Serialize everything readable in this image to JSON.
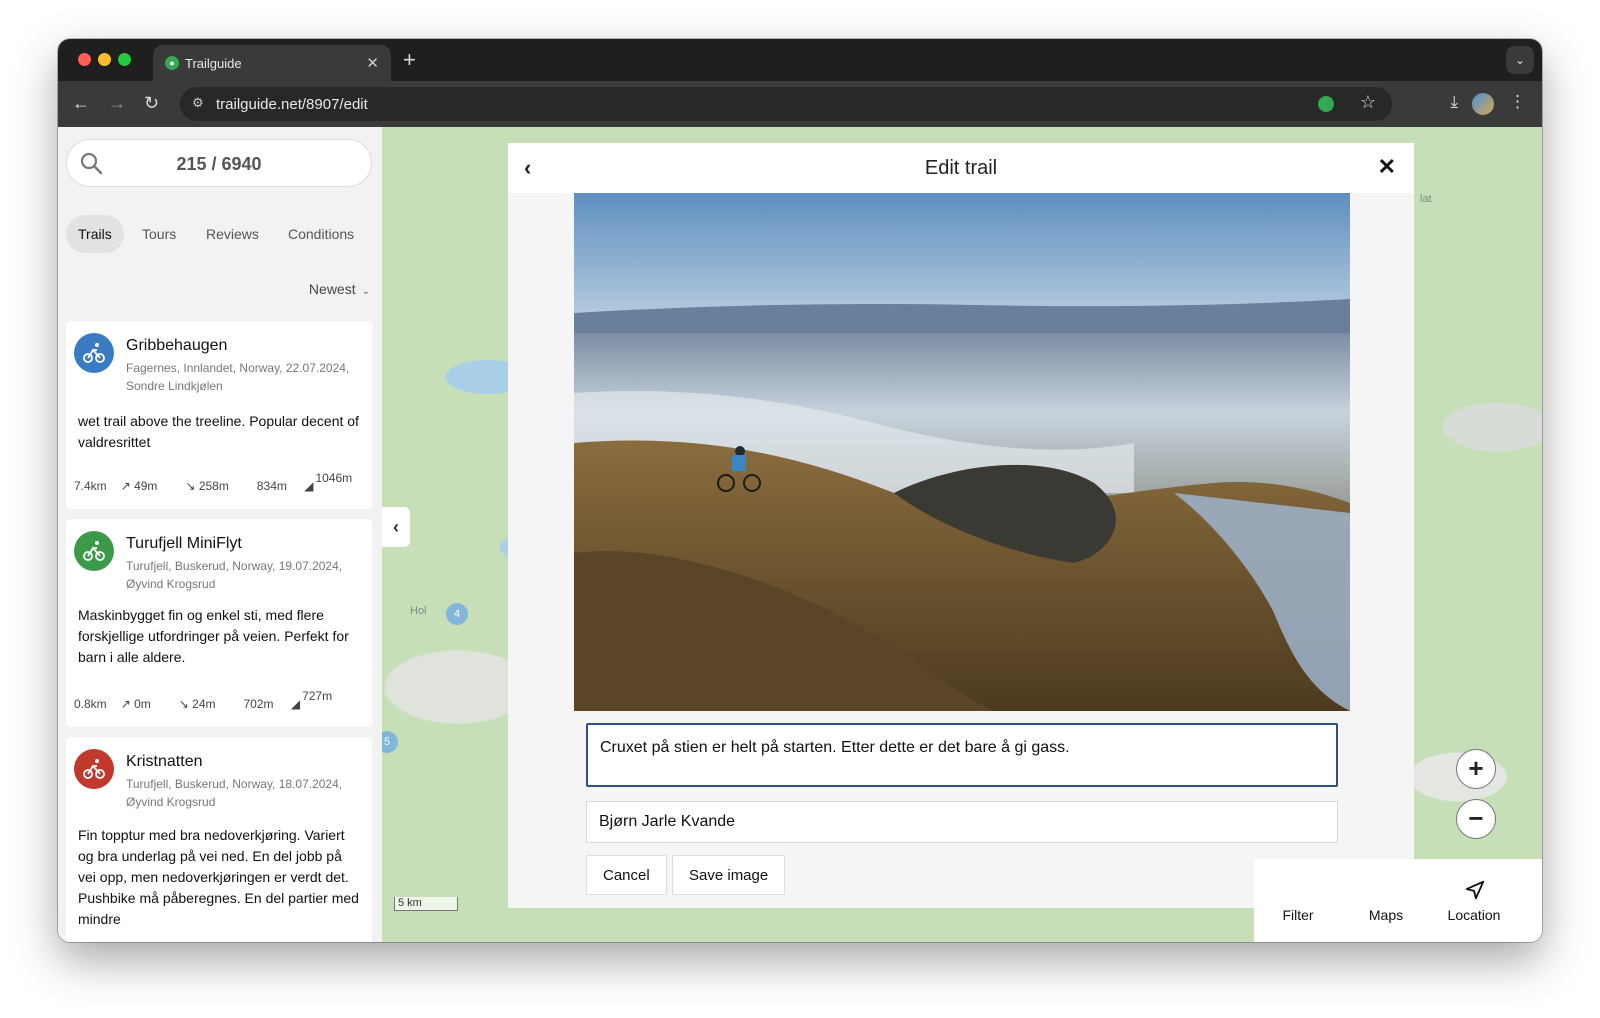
{
  "browser": {
    "tab_title": "Trailguide",
    "tab_favicon": "trailguide-favicon",
    "url": "trailguide.net/8907/edit"
  },
  "sidebar": {
    "search_count": "215 / 6940",
    "tabs": [
      "Trails",
      "Tours",
      "Reviews",
      "Conditions"
    ],
    "active_tab": "Trails",
    "sort_label": "Newest",
    "cards": [
      {
        "name": "Gribbehaugen",
        "location": "Fagernes, Innlandet, Norway, 22.07.2024,",
        "author": "Sondre Lindkjølen",
        "description": "wet trail above the treeline. Popular decent of valdresrittet",
        "distance": "7.4km",
        "ascent": "49m",
        "descent": "258m",
        "min_alt": "834m",
        "max_alt": "1046m",
        "color": "#3a7cc4"
      },
      {
        "name": "Turufjell MiniFlyt",
        "location": "Turufjell, Buskerud, Norway, 19.07.2024,",
        "author": "Øyvind Krogsrud",
        "description": "Maskinbygget fin og enkel sti, med flere forskjellige utfordringer på veien. Perfekt for barn i alle aldere.",
        "distance": "0.8km",
        "ascent": "0m",
        "descent": "24m",
        "min_alt": "702m",
        "max_alt": "727m",
        "color": "#3a9a4a"
      },
      {
        "name": "Kristnatten",
        "location": "Turufjell, Buskerud, Norway, 18.07.2024,",
        "author": "Øyvind Krogsrud",
        "description": "Fin topptur med bra nedoverkjøring. Variert og bra underlag på vei ned. En del jobb på vei opp, men nedoverkjøringen er verdt det. Pushbike må påberegnes. En del partier med mindre",
        "color": "#c0392b"
      }
    ]
  },
  "map": {
    "scale_label": "5 km",
    "labels": [
      "Hol",
      "lat"
    ],
    "markers": [
      "4",
      "5"
    ]
  },
  "modal": {
    "title": "Edit trail",
    "caption_value": "Cruxet på stien er helt på starten. Etter dette er det bare å gi gass.",
    "credit_value": "Bjørn Jarle Kvande",
    "cancel_label": "Cancel",
    "save_label": "Save image"
  },
  "bottom_nav": {
    "filter_label": "Filter",
    "maps_label": "Maps",
    "location_label": "Location"
  }
}
